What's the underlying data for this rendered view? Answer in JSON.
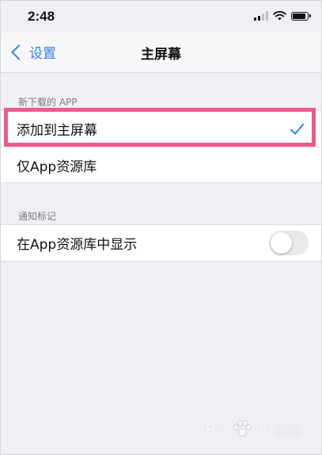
{
  "status_bar": {
    "time": "2:48"
  },
  "nav": {
    "back_label": "设置",
    "title": "主屏幕"
  },
  "new_downloads": {
    "header": "新下载的 APP",
    "options": [
      {
        "label": "添加到主屏幕",
        "selected": true
      },
      {
        "label": "仅App资源库",
        "selected": false
      }
    ]
  },
  "notification_badges": {
    "header": "通知标记",
    "row_label": "在App资源库中显示",
    "toggle_on": false
  },
  "colors": {
    "accent": "#2f80ed",
    "highlight": "#ee5a8e",
    "background": "#efeff4"
  },
  "watermark": {
    "brand": "Bai",
    "brand_suffix": "du",
    "text": "经验"
  },
  "icons": [
    "signal-icon",
    "wifi-icon",
    "battery-icon",
    "chevron-left-icon",
    "checkmark-icon",
    "paw-icon"
  ]
}
